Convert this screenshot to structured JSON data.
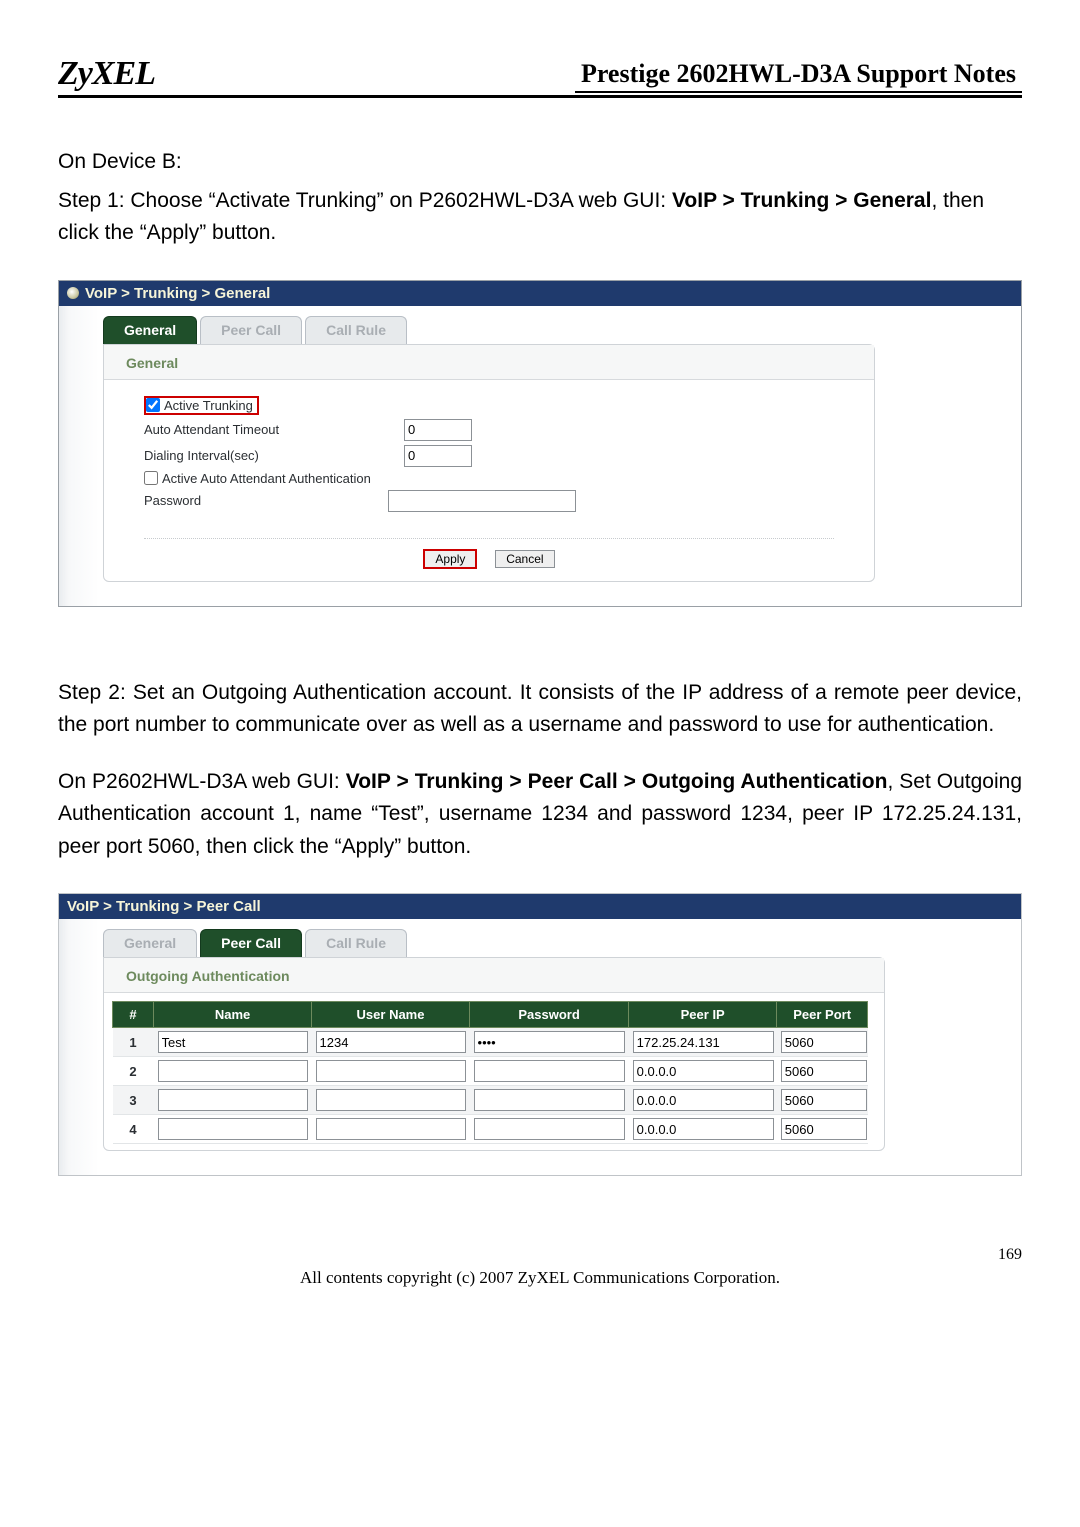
{
  "header": {
    "logo": "ZyXEL",
    "title": "Prestige 2602HWL-D3A Support Notes"
  },
  "intro": {
    "line1": "On Device B:",
    "step1_pre": "Step    1: Choose “Activate Trunking” on P2602HWL-D3A web GUI: ",
    "step1_bold": "VoIP > Trunking > General",
    "step1_post": ", then click the “Apply” button."
  },
  "shot1": {
    "breadcrumb": "VoIP > Trunking > General",
    "tabs": {
      "general": "General",
      "peer": "Peer Call",
      "rule": "Call Rule"
    },
    "section": "General",
    "fields": {
      "active_trunking": "Active Trunking",
      "auto_timeout_label": "Auto Attendant Timeout",
      "auto_timeout_value": "0",
      "dialing_interval_label": "Dialing Interval(sec)",
      "dialing_interval_value": "0",
      "active_auth": "Active Auto Attendant Authentication",
      "password_label": "Password",
      "password_value": ""
    },
    "buttons": {
      "apply": "Apply",
      "cancel": "Cancel"
    }
  },
  "mid": {
    "step2": "Step    2: Set an Outgoing Authentication account. It consists of the IP address of a remote peer device, the port number to communicate over as well as a username and password to use for authentication.",
    "p2_pre": "On P2602HWL-D3A web GUI: ",
    "p2_bold": "VoIP > Trunking > Peer Call > Outgoing Authentication",
    "p2_post": ", Set Outgoing Authentication account 1, name “Test”, username 1234 and password 1234, peer IP 172.25.24.131, peer port 5060, then click the “Apply” button."
  },
  "shot2": {
    "breadcrumb": "VoIP > Trunking > Peer Call",
    "tabs": {
      "general": "General",
      "peer": "Peer Call",
      "rule": "Call Rule"
    },
    "section": "Outgoing Authentication",
    "headers": {
      "idx": "#",
      "name": "Name",
      "user": "User Name",
      "pass": "Password",
      "ip": "Peer IP",
      "port": "Peer Port"
    },
    "rows": [
      {
        "idx": "1",
        "name": "Test",
        "user": "1234",
        "pass": "••••",
        "ip": "172.25.24.131",
        "port": "5060"
      },
      {
        "idx": "2",
        "name": "",
        "user": "",
        "pass": "",
        "ip": "0.0.0.0",
        "port": "5060"
      },
      {
        "idx": "3",
        "name": "",
        "user": "",
        "pass": "",
        "ip": "0.0.0.0",
        "port": "5060"
      },
      {
        "idx": "4",
        "name": "",
        "user": "",
        "pass": "",
        "ip": "0.0.0.0",
        "port": "5060"
      }
    ]
  },
  "footer": {
    "page": "169",
    "copyright": "All contents copyright (c) 2007 ZyXEL Communications Corporation."
  }
}
